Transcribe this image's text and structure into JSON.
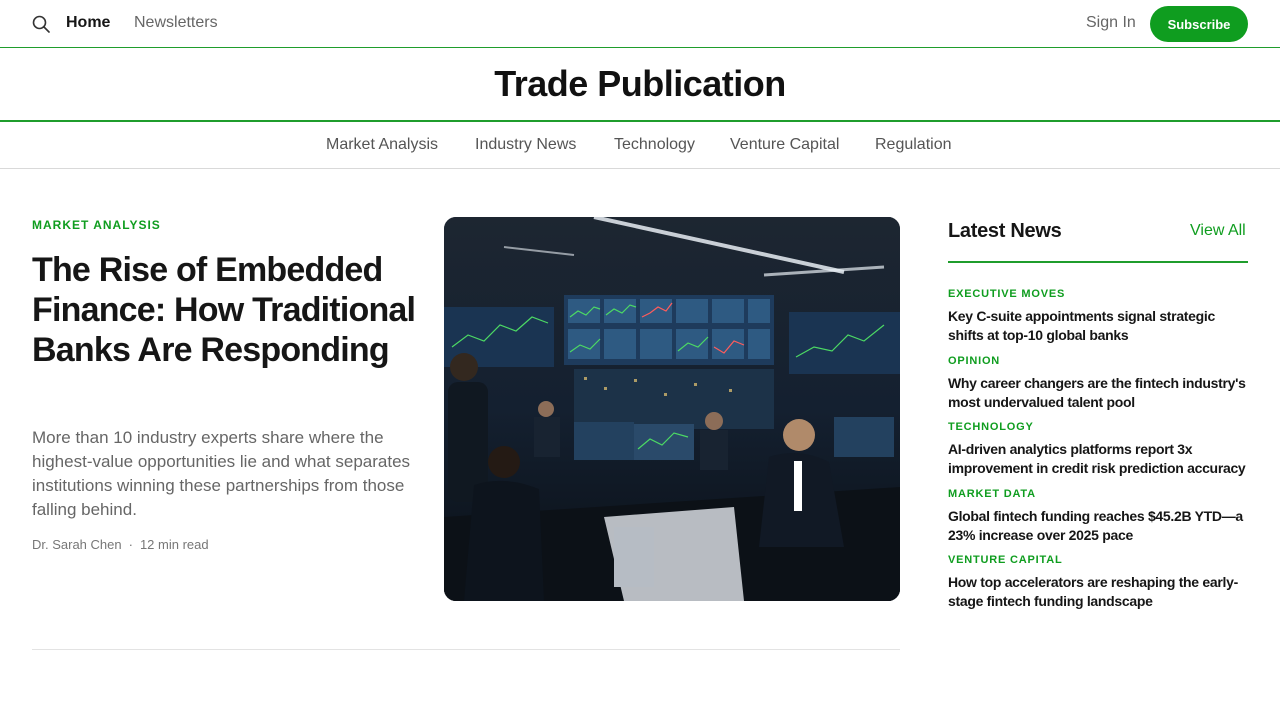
{
  "topbar": {
    "home_label": "Home",
    "newsletters_label": "Newsletters",
    "signin_label": "Sign In",
    "subscribe_label": "Subscribe"
  },
  "brand": {
    "title": "Trade Publication"
  },
  "categories": [
    "Market Analysis",
    "Industry News",
    "Technology",
    "Venture Capital",
    "Regulation"
  ],
  "hero": {
    "category": "MARKET ANALYSIS",
    "title": "The Rise of Embedded Finance: How Traditional Banks Are Responding",
    "description": "More than 10 industry experts share where the highest-value opportunities lie and what separates institutions winning these partnerships from those falling behind.",
    "author": "Dr. Sarah Chen",
    "separator": "·",
    "read_time": "12 min read"
  },
  "latest": {
    "title": "Latest News",
    "view_all_label": "View All",
    "items": [
      {
        "category": "EXECUTIVE MOVES",
        "headline": "Key C-suite appointments signal strategic shifts at top-10 global banks"
      },
      {
        "category": "OPINION",
        "headline": "Why career changers are the fintech industry's most undervalued talent pool"
      },
      {
        "category": "TECHNOLOGY",
        "headline": "AI-driven analytics platforms report 3x improvement in credit risk prediction accuracy"
      },
      {
        "category": "MARKET DATA",
        "headline": "Global fintech funding reaches $45.2B YTD—a 23% increase over 2025 pace"
      },
      {
        "category": "VENTURE CAPITAL",
        "headline": "How top accelerators are reshaping the early-stage fintech funding landscape"
      }
    ]
  },
  "colors": {
    "accent": "#0f9d1f",
    "rule": "#1f9d2c"
  }
}
